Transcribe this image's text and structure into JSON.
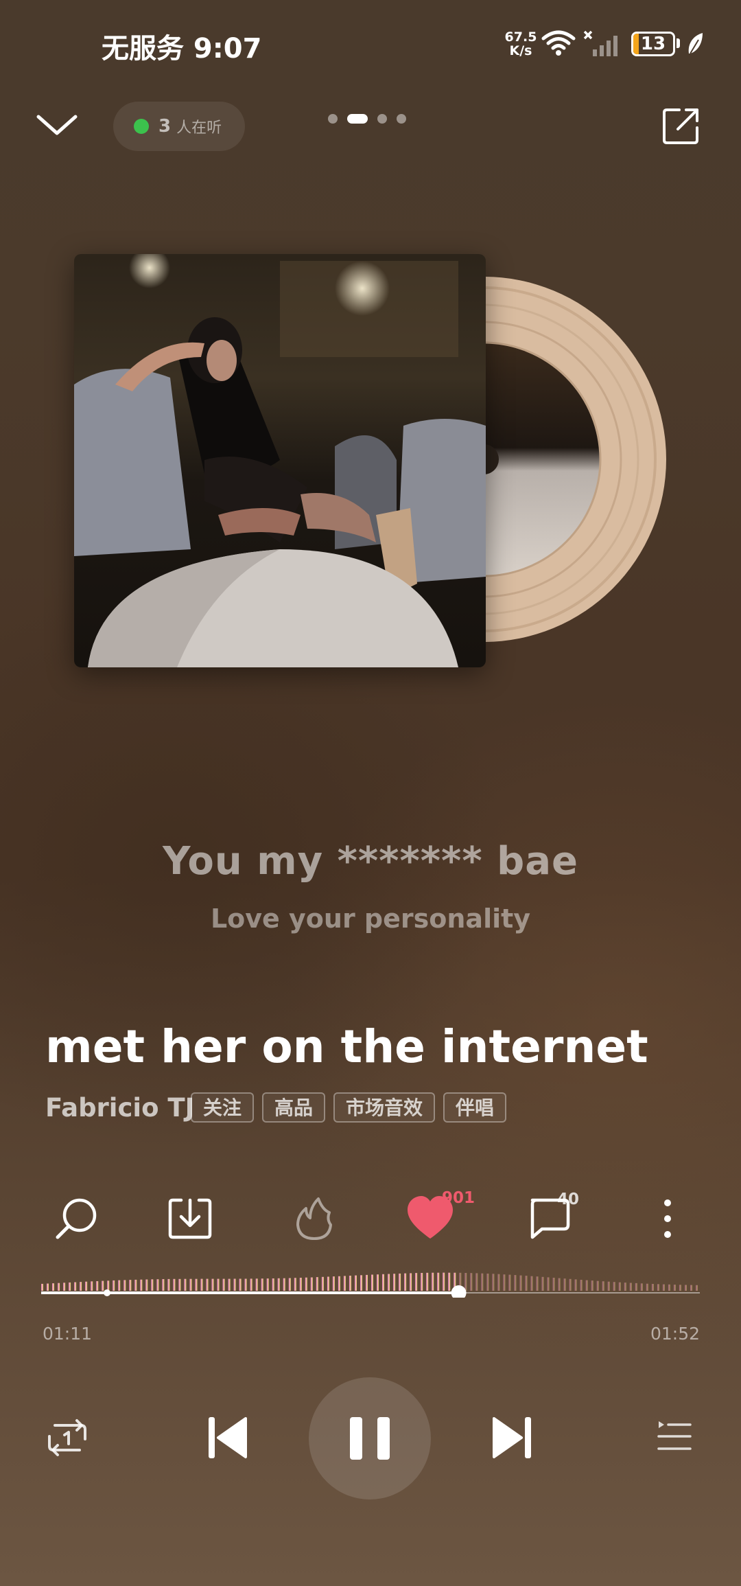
{
  "status_bar": {
    "carrier_time": "无服务 9:07",
    "speed_value": "67.5",
    "speed_unit": "K/s",
    "battery": "13"
  },
  "top_bar": {
    "listeners_count": "3",
    "listeners_label": "人在听",
    "page_index": 2,
    "page_count": 4
  },
  "lyrics": {
    "current": "You my ******* bae",
    "next": "Love your personality"
  },
  "song": {
    "title": "met her on the internet",
    "artist": "Fabricio TJ",
    "tags": [
      "关注",
      "高品",
      "市场音效",
      "伴唱"
    ]
  },
  "actions": {
    "like_count": "901",
    "comment_count": "40",
    "liked": true
  },
  "player": {
    "current_time": "01:11",
    "total_time": "01:52",
    "progress": 0.634,
    "state": "playing"
  },
  "colors": {
    "like_red": "#ef5a6d",
    "listening_green": "#3cc24d",
    "battery_orange": "#f4a51c",
    "wave_pink": "#f08ac8",
    "wave_yellow": "#f3e27a"
  },
  "icons": [
    "collapse-chevron-icon",
    "share-icon",
    "search-icon",
    "download-icon",
    "fire-icon",
    "heart-icon",
    "comment-icon",
    "more-icon",
    "repeat-one-icon",
    "previous-icon",
    "pause-icon",
    "next-icon",
    "playlist-icon"
  ]
}
